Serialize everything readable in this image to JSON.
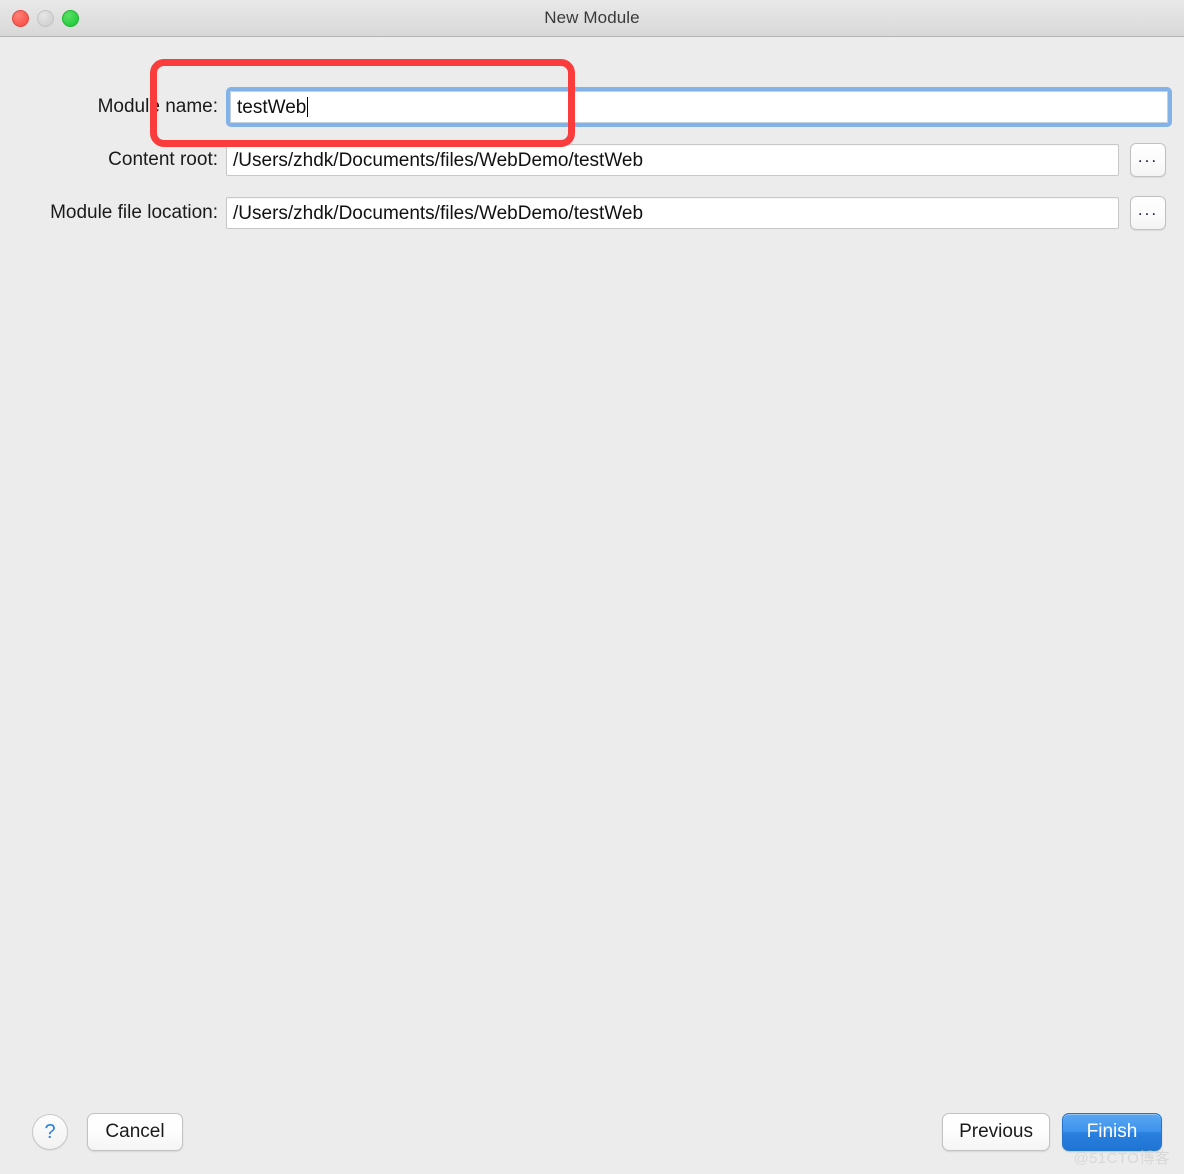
{
  "window": {
    "title": "New Module",
    "traffic_lights": {
      "close": "close-button",
      "minimize": "minimize-button",
      "maximize": "maximize-button"
    }
  },
  "form": {
    "fields": [
      {
        "label": "Module name:",
        "value": "testWeb",
        "focused": true,
        "has_browse": false
      },
      {
        "label": "Content root:",
        "value": "/Users/zhdk/Documents/files/WebDemo/testWeb",
        "focused": false,
        "has_browse": true,
        "browse_label": "..."
      },
      {
        "label": "Module file location:",
        "value": "/Users/zhdk/Documents/files/WebDemo/testWeb",
        "focused": false,
        "has_browse": true,
        "browse_label": "..."
      }
    ]
  },
  "annotation": {
    "color": "#fa3c3c",
    "target": "module-name-row"
  },
  "footer": {
    "help_label": "?",
    "cancel_label": "Cancel",
    "previous_label": "Previous",
    "finish_label": "Finish",
    "finish_color": "#2a80df"
  },
  "watermark": {
    "text": "@51CTO博客"
  }
}
